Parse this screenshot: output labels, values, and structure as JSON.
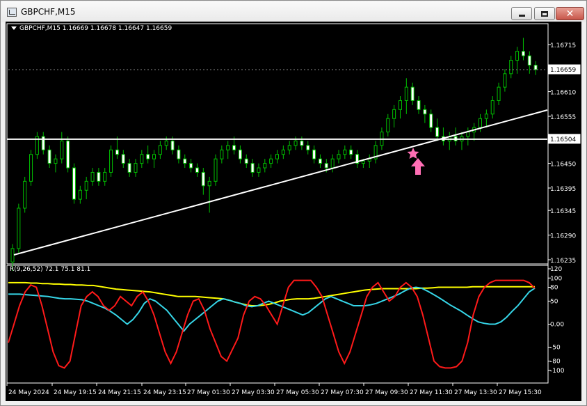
{
  "window": {
    "title": "GBPCHF,M15",
    "icon": "chart-window-icon",
    "buttons": [
      "minimize-icon",
      "maximize-icon",
      "close-icon"
    ]
  },
  "colors": {
    "background": "#000000",
    "candle_up": "#ffffff",
    "candle_down": "#ffffff",
    "wick": "#00c000",
    "trendline": "#ffffff",
    "price_line": "#ffffff",
    "red": "#ff1a1a",
    "cyan": "#36d6e8",
    "yellow": "#ffff00",
    "marker": "#ff6eb4"
  },
  "price_chart": {
    "ohlc_text": "GBPCHF,M15  1.16669 1.16678 1.16647 1.16659",
    "current_price": "1.16659",
    "line_price": "1.16504",
    "y_ticks": [
      "1.16715",
      "1.16610",
      "1.16555",
      "1.16450",
      "1.16395",
      "1.16345",
      "1.16290",
      "1.16235"
    ],
    "markers": [
      "star-icon",
      "arrow-up-icon"
    ]
  },
  "indicator": {
    "label": "R(9,26,52) 72.1 75.1 81.1",
    "y_ticks": [
      "120",
      "100",
      "80",
      "50",
      "0.00",
      "-50",
      "-80",
      "-100"
    ]
  },
  "x_axis": [
    "24 May 2024",
    "24 May 19:15",
    "24 May 21:15",
    "24 May 23:15",
    "27 May 01:30",
    "27 May 03:30",
    "27 May 05:30",
    "27 May 07:30",
    "27 May 09:30",
    "27 May 11:30",
    "27 May 13:30",
    "27 May 15:30"
  ],
  "candles": [
    [
      1.1623,
      1.1627,
      1.1621,
      1.1626
    ],
    [
      1.1626,
      1.1636,
      1.1625,
      1.1635
    ],
    [
      1.1635,
      1.1642,
      1.1634,
      1.1641
    ],
    [
      1.1641,
      1.1648,
      1.164,
      1.1647
    ],
    [
      1.1647,
      1.1652,
      1.1646,
      1.1651
    ],
    [
      1.1651,
      1.1652,
      1.1647,
      1.1648
    ],
    [
      1.1648,
      1.1649,
      1.1644,
      1.1645
    ],
    [
      1.1645,
      1.1647,
      1.1643,
      1.1646
    ],
    [
      1.1646,
      1.1652,
      1.1645,
      1.165
    ],
    [
      1.165,
      1.1651,
      1.1643,
      1.1644
    ],
    [
      1.1644,
      1.1645,
      1.1636,
      1.1637
    ],
    [
      1.1637,
      1.164,
      1.1636,
      1.1639
    ],
    [
      1.1639,
      1.1642,
      1.1637,
      1.1641
    ],
    [
      1.1641,
      1.1644,
      1.164,
      1.1643
    ],
    [
      1.1643,
      1.1644,
      1.164,
      1.1641
    ],
    [
      1.1641,
      1.1644,
      1.164,
      1.1643
    ],
    [
      1.1643,
      1.1649,
      1.1642,
      1.1648
    ],
    [
      1.1648,
      1.1651,
      1.1646,
      1.1647
    ],
    [
      1.1647,
      1.1648,
      1.1644,
      1.1645
    ],
    [
      1.1645,
      1.1646,
      1.1642,
      1.1643
    ],
    [
      1.1643,
      1.1646,
      1.1642,
      1.1645
    ],
    [
      1.1645,
      1.1648,
      1.1644,
      1.1647
    ],
    [
      1.1647,
      1.1649,
      1.1645,
      1.1646
    ],
    [
      1.1646,
      1.1648,
      1.1644,
      1.1647
    ],
    [
      1.1647,
      1.165,
      1.1646,
      1.1649
    ],
    [
      1.1649,
      1.1651,
      1.1648,
      1.165
    ],
    [
      1.165,
      1.1651,
      1.1647,
      1.1648
    ],
    [
      1.1648,
      1.1649,
      1.1645,
      1.1646
    ],
    [
      1.1646,
      1.1647,
      1.1644,
      1.1645
    ],
    [
      1.1645,
      1.1646,
      1.1643,
      1.1644
    ],
    [
      1.1644,
      1.1645,
      1.1642,
      1.1643
    ],
    [
      1.1643,
      1.1644,
      1.1638,
      1.164
    ],
    [
      1.164,
      1.1642,
      1.1634,
      1.1641
    ],
    [
      1.1641,
      1.1647,
      1.164,
      1.1646
    ],
    [
      1.1646,
      1.1649,
      1.1645,
      1.1648
    ],
    [
      1.1648,
      1.165,
      1.1646,
      1.1649
    ],
    [
      1.1649,
      1.1651,
      1.1647,
      1.1648
    ],
    [
      1.1648,
      1.1649,
      1.1645,
      1.1646
    ],
    [
      1.1646,
      1.1647,
      1.1644,
      1.1645
    ],
    [
      1.1645,
      1.1646,
      1.1642,
      1.1643
    ],
    [
      1.1643,
      1.1645,
      1.1642,
      1.1644
    ],
    [
      1.1644,
      1.1646,
      1.1643,
      1.1645
    ],
    [
      1.1645,
      1.1647,
      1.1644,
      1.1646
    ],
    [
      1.1646,
      1.1648,
      1.1645,
      1.1647
    ],
    [
      1.1647,
      1.1649,
      1.1646,
      1.1648
    ],
    [
      1.1648,
      1.165,
      1.1647,
      1.1649
    ],
    [
      1.1649,
      1.1651,
      1.1648,
      1.165
    ],
    [
      1.165,
      1.1651,
      1.1648,
      1.1649
    ],
    [
      1.1649,
      1.165,
      1.1647,
      1.1648
    ],
    [
      1.1648,
      1.1649,
      1.1645,
      1.1646
    ],
    [
      1.1646,
      1.1647,
      1.1644,
      1.1645
    ],
    [
      1.1645,
      1.1646,
      1.1643,
      1.1644
    ],
    [
      1.1644,
      1.1647,
      1.1643,
      1.1646
    ],
    [
      1.1646,
      1.1648,
      1.1645,
      1.1647
    ],
    [
      1.1647,
      1.1649,
      1.1646,
      1.1648
    ],
    [
      1.1648,
      1.1649,
      1.1646,
      1.1647
    ],
    [
      1.1647,
      1.1648,
      1.1644,
      1.1645
    ],
    [
      1.1645,
      1.1646,
      1.1644,
      1.16455
    ],
    [
      1.16455,
      1.1647,
      1.1644,
      1.1646
    ],
    [
      1.1646,
      1.165,
      1.1645,
      1.1649
    ],
    [
      1.1649,
      1.1653,
      1.1648,
      1.1652
    ],
    [
      1.1652,
      1.1656,
      1.1651,
      1.1655
    ],
    [
      1.1655,
      1.1658,
      1.1653,
      1.1657
    ],
    [
      1.1657,
      1.166,
      1.1655,
      1.1659
    ],
    [
      1.1659,
      1.1664,
      1.1656,
      1.1662
    ],
    [
      1.1662,
      1.1663,
      1.1658,
      1.1659
    ],
    [
      1.1659,
      1.166,
      1.1656,
      1.1657
    ],
    [
      1.1657,
      1.1658,
      1.1654,
      1.1656
    ],
    [
      1.1656,
      1.1657,
      1.1652,
      1.1653
    ],
    [
      1.1653,
      1.1655,
      1.165,
      1.1651
    ],
    [
      1.1651,
      1.1653,
      1.1649,
      1.165
    ],
    [
      1.165,
      1.1652,
      1.1648,
      1.1651
    ],
    [
      1.1651,
      1.1653,
      1.1649,
      1.165
    ],
    [
      1.165,
      1.1652,
      1.1648,
      1.1651
    ],
    [
      1.1651,
      1.1653,
      1.1649,
      1.1652
    ],
    [
      1.1652,
      1.1654,
      1.165,
      1.1653
    ],
    [
      1.1653,
      1.1656,
      1.1652,
      1.1655
    ],
    [
      1.1655,
      1.1657,
      1.1653,
      1.1656
    ],
    [
      1.1656,
      1.166,
      1.1655,
      1.1659
    ],
    [
      1.1659,
      1.1663,
      1.1658,
      1.1662
    ],
    [
      1.1662,
      1.1666,
      1.1661,
      1.1665
    ],
    [
      1.1665,
      1.1669,
      1.1664,
      1.1668
    ],
    [
      1.1668,
      1.1671,
      1.1665,
      1.167
    ],
    [
      1.167,
      1.1673,
      1.1668,
      1.1669
    ],
    [
      1.1669,
      1.167,
      1.1665,
      1.16669
    ],
    [
      1.16669,
      1.16678,
      1.16647,
      1.16659
    ]
  ],
  "red_series": [
    -40,
    0,
    40,
    70,
    85,
    80,
    40,
    -10,
    -60,
    -90,
    -95,
    -80,
    -20,
    40,
    60,
    70,
    60,
    40,
    30,
    40,
    60,
    50,
    40,
    60,
    70,
    50,
    20,
    -20,
    -60,
    -85,
    -60,
    -20,
    20,
    50,
    55,
    30,
    -10,
    -40,
    -70,
    -80,
    -55,
    -30,
    20,
    50,
    60,
    55,
    40,
    20,
    0,
    40,
    80,
    95,
    95,
    95,
    95,
    80,
    60,
    20,
    -20,
    -60,
    -85,
    -60,
    -20,
    20,
    60,
    80,
    90,
    70,
    50,
    60,
    80,
    90,
    80,
    60,
    20,
    -30,
    -80,
    -92,
    -95,
    -95,
    -92,
    -80,
    -40,
    20,
    60,
    80,
    90,
    95,
    95,
    95,
    95,
    95,
    95,
    90,
    78
  ],
  "cyan_series": [
    65,
    65,
    65,
    64,
    63,
    62,
    61,
    60,
    58,
    56,
    55,
    55,
    54,
    53,
    50,
    45,
    40,
    35,
    28,
    20,
    10,
    0,
    10,
    25,
    45,
    55,
    50,
    40,
    30,
    15,
    0,
    -15,
    0,
    10,
    20,
    30,
    40,
    50,
    55,
    52,
    48,
    45,
    40,
    38,
    40,
    45,
    50,
    45,
    40,
    35,
    30,
    25,
    20,
    25,
    35,
    45,
    55,
    60,
    55,
    50,
    45,
    40,
    40,
    40,
    42,
    45,
    50,
    55,
    60,
    65,
    72,
    78,
    80,
    78,
    72,
    65,
    58,
    50,
    42,
    35,
    28,
    20,
    12,
    5,
    2,
    0,
    0,
    5,
    15,
    28,
    40,
    55,
    70,
    78
  ],
  "yellow_series": [
    90,
    90,
    90,
    90,
    89,
    89,
    88,
    88,
    87,
    87,
    86,
    86,
    85,
    85,
    84,
    84,
    82,
    80,
    78,
    76,
    75,
    74,
    73,
    72,
    71,
    70,
    68,
    66,
    64,
    62,
    60,
    60,
    60,
    60,
    59,
    58,
    57,
    56,
    55,
    52,
    48,
    45,
    42,
    40,
    40,
    41,
    43,
    46,
    50,
    52,
    54,
    55,
    55,
    55,
    56,
    58,
    60,
    62,
    64,
    66,
    68,
    70,
    72,
    74,
    75,
    76,
    77,
    77,
    77,
    77,
    77,
    77,
    77,
    78,
    78,
    79,
    80,
    80,
    80,
    80,
    80,
    80,
    81,
    81,
    81,
    81,
    81,
    81,
    81,
    81,
    81,
    81,
    81,
    81
  ]
}
